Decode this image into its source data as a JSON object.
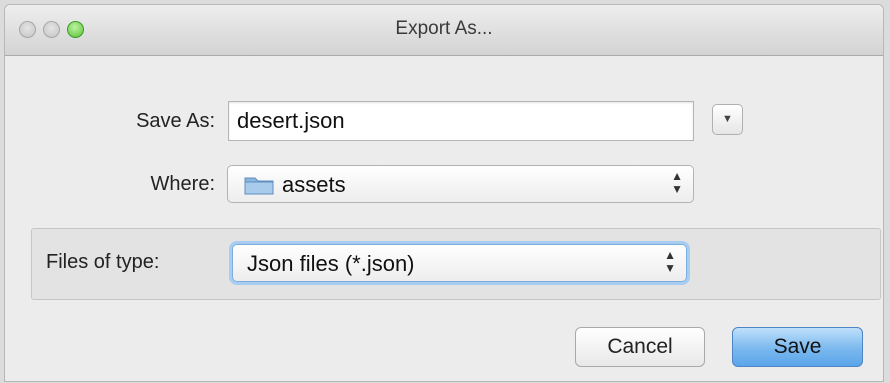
{
  "window": {
    "title": "Export As..."
  },
  "form": {
    "save_as_label": "Save As:",
    "save_as_value": "desert.json",
    "where_label": "Where:",
    "where_value": "assets",
    "files_of_type_label": "Files of type:",
    "files_of_type_value": "Json files (*.json)"
  },
  "buttons": {
    "cancel_label": "Cancel",
    "save_label": "Save"
  },
  "icons": {
    "folder": "folder-icon",
    "expand": "chevron-down-icon",
    "stepper": "updown-arrows-icon"
  },
  "colors": {
    "default_button": "#6cb0ed",
    "zoom_button": "#58c132",
    "folder": "#8ab6df"
  }
}
